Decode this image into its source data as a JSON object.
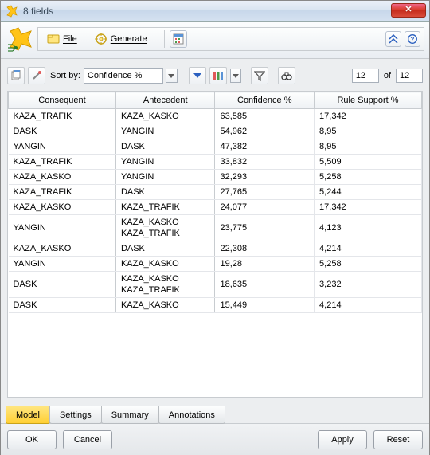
{
  "window": {
    "title": "8 fields"
  },
  "toolbar": {
    "file": "File",
    "generate": "Generate"
  },
  "sort": {
    "label": "Sort by:",
    "value": "Confidence %"
  },
  "pager": {
    "current": "12",
    "of_label": "of",
    "total": "12"
  },
  "columns": [
    "Consequent",
    "Antecedent",
    "Confidence %",
    "Rule Support %"
  ],
  "rows": [
    {
      "consequent": "KAZA_TRAFIK",
      "antecedent": "KAZA_KASKO",
      "confidence": "63,585",
      "support": "17,342"
    },
    {
      "consequent": "DASK",
      "antecedent": "YANGIN",
      "confidence": "54,962",
      "support": "8,95"
    },
    {
      "consequent": "YANGIN",
      "antecedent": "DASK",
      "confidence": "47,382",
      "support": "8,95"
    },
    {
      "consequent": "KAZA_TRAFIK",
      "antecedent": "YANGIN",
      "confidence": "33,832",
      "support": "5,509"
    },
    {
      "consequent": "KAZA_KASKO",
      "antecedent": "YANGIN",
      "confidence": "32,293",
      "support": "5,258"
    },
    {
      "consequent": "KAZA_TRAFIK",
      "antecedent": "DASK",
      "confidence": "27,765",
      "support": "5,244"
    },
    {
      "consequent": "KAZA_KASKO",
      "antecedent": "KAZA_TRAFIK",
      "confidence": "24,077",
      "support": "17,342"
    },
    {
      "consequent": "YANGIN",
      "antecedent": "KAZA_KASKO\nKAZA_TRAFIK",
      "confidence": "23,775",
      "support": "4,123"
    },
    {
      "consequent": "KAZA_KASKO",
      "antecedent": "DASK",
      "confidence": "22,308",
      "support": "4,214"
    },
    {
      "consequent": "YANGIN",
      "antecedent": "KAZA_KASKO",
      "confidence": "19,28",
      "support": "5,258"
    },
    {
      "consequent": "DASK",
      "antecedent": "KAZA_KASKO\nKAZA_TRAFIK",
      "confidence": "18,635",
      "support": "3,232"
    },
    {
      "consequent": "DASK",
      "antecedent": "KAZA_KASKO",
      "confidence": "15,449",
      "support": "4,214"
    }
  ],
  "tabs": {
    "model": "Model",
    "settings": "Settings",
    "summary": "Summary",
    "annotations": "Annotations"
  },
  "buttons": {
    "ok": "OK",
    "cancel": "Cancel",
    "apply": "Apply",
    "reset": "Reset"
  }
}
